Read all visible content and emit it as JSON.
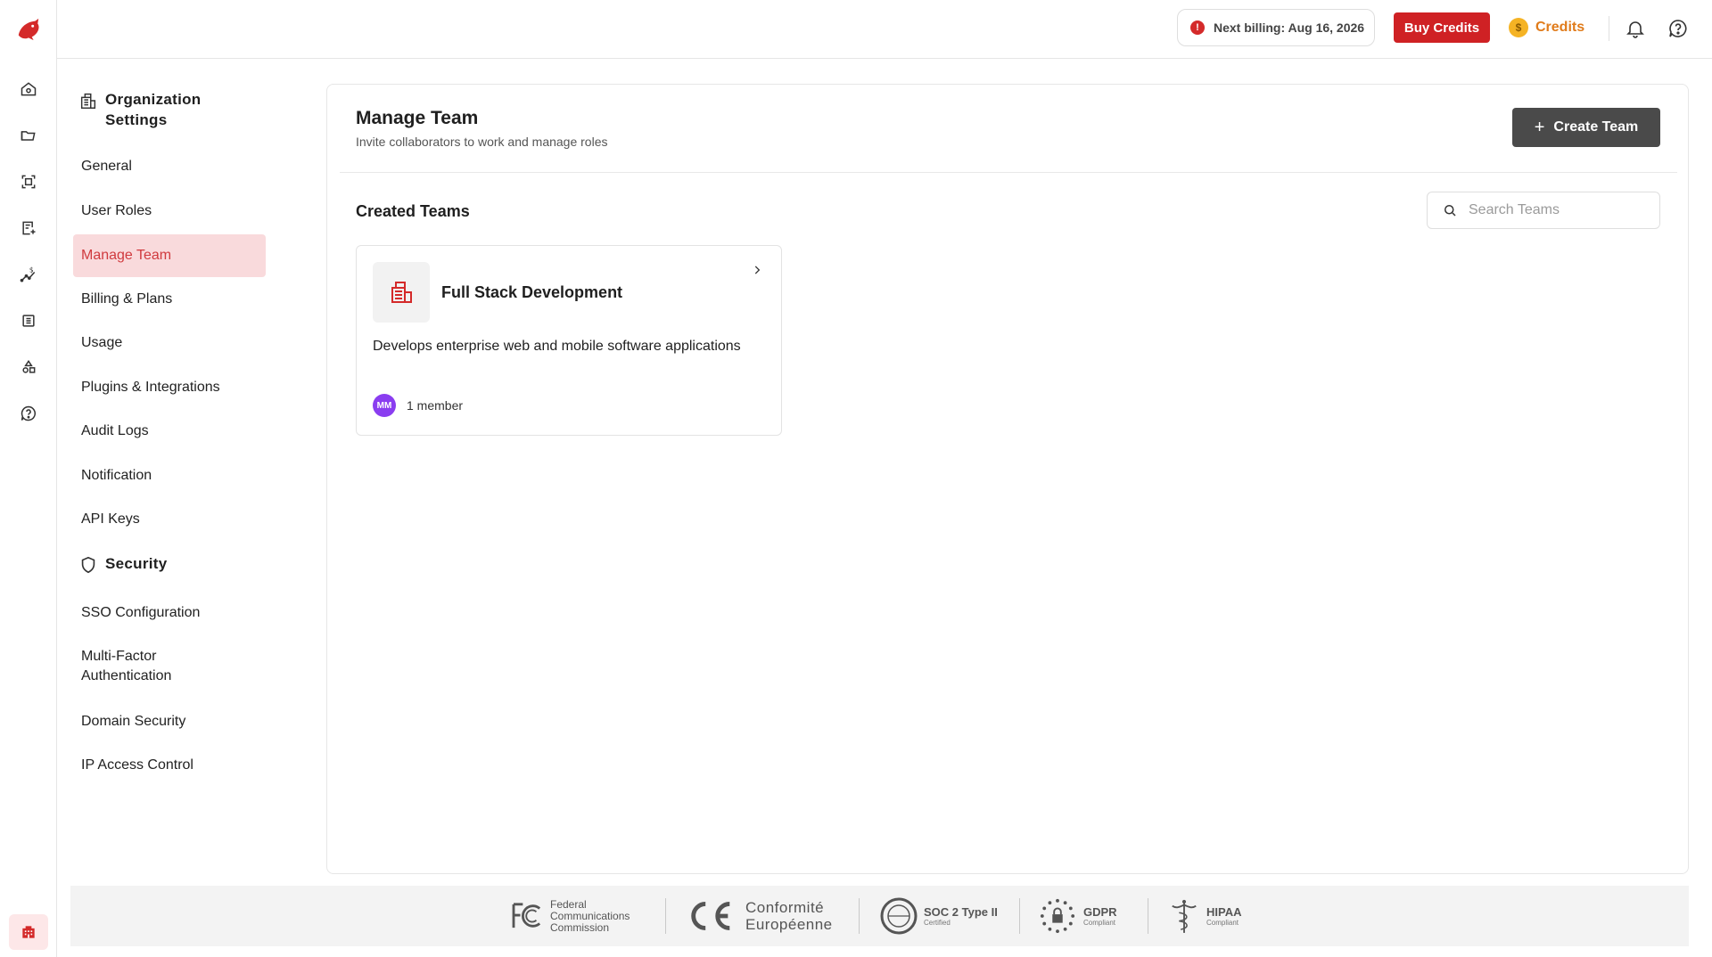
{
  "topbar": {
    "billing_text": "Next billing: Aug 16, 2026",
    "buy_credits_label": "Buy Credits",
    "credits_label": "Credits",
    "coin_symbol": "$"
  },
  "rail": {
    "icons": [
      "home-icon",
      "folder-icon",
      "scan-icon",
      "document-add-icon",
      "pricing-icon",
      "table-icon",
      "shapes-icon",
      "help-icon"
    ]
  },
  "nav": {
    "org_heading_line1": "Organization",
    "org_heading_line2": "Settings",
    "org_items": [
      {
        "label": "General"
      },
      {
        "label": "User Roles"
      },
      {
        "label": "Manage Team"
      },
      {
        "label": "Billing & Plans"
      },
      {
        "label": "Usage"
      },
      {
        "label": "Plugins & Integrations"
      },
      {
        "label": "Audit Logs"
      },
      {
        "label": "Notification"
      },
      {
        "label": "API Keys"
      }
    ],
    "security_heading": "Security",
    "security_items": [
      {
        "label": "SSO Configuration"
      },
      {
        "label": "Multi-Factor Authentication"
      },
      {
        "label": "Domain Security"
      },
      {
        "label": "IP Access Control"
      }
    ]
  },
  "main": {
    "title": "Manage Team",
    "subtitle": "Invite collaborators to work and manage roles",
    "create_button": "Create Team",
    "section_title": "Created Teams",
    "search_placeholder": "Search Teams",
    "teams": [
      {
        "name": "Full Stack Development",
        "description": "Develops enterprise web and mobile software applications",
        "avatar_initials": "MM",
        "member_count": "1 member"
      }
    ]
  },
  "footer": {
    "fcc_line1": "Federal",
    "fcc_line2": "Communications",
    "fcc_line3": "Commission",
    "ce_line1": "Conformité",
    "ce_line2": "Européenne",
    "soc_title": "SOC 2 Type II",
    "soc_sub": "Certified",
    "gdpr_title": "GDPR",
    "gdpr_sub": "Compliant",
    "hipaa_title": "HIPAA",
    "hipaa_sub": "Compliant"
  },
  "colors": {
    "brand_red": "#cf2124",
    "active_bg": "#f9dadc",
    "credits_orange": "#e07b1a",
    "dark_button": "#4a4a4a",
    "avatar_purple": "#8a3df0"
  }
}
